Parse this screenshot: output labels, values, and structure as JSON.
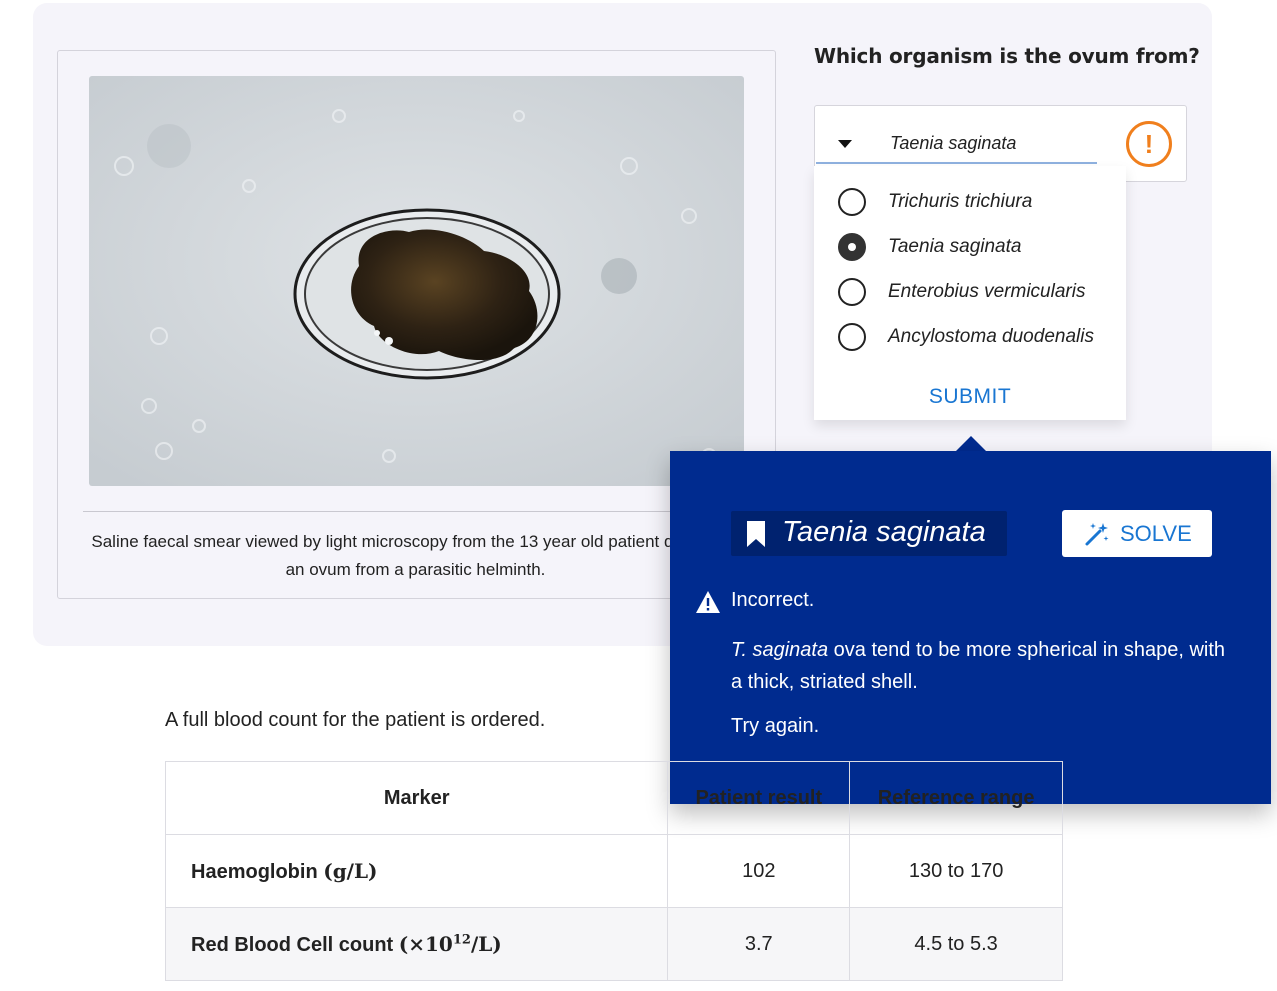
{
  "figure": {
    "caption": "Saline faecal smear viewed by light microscopy from the 13 year old patient displaying an ovum from a parasitic helminth."
  },
  "question": {
    "prompt": "Which organism is the ovum from?",
    "selected_value": "Taenia saginata",
    "options": [
      {
        "label": "Trichuris trichiura",
        "checked": false
      },
      {
        "label": "Taenia saginata",
        "checked": true
      },
      {
        "label": "Enterobius vermicularis",
        "checked": false
      },
      {
        "label": "Ancylostoma duodenalis",
        "checked": false
      }
    ],
    "submit_label": "SUBMIT",
    "status_icon": "alert-icon",
    "status_color": "#f07f1d"
  },
  "feedback": {
    "answer": "Taenia saginata",
    "solve_label": "SOLVE",
    "verdict": "Incorrect.",
    "explanation_italic": "T. saginata",
    "explanation_rest": " ova tend to be more spherical in shape, with a thick, striated shell.",
    "retry": "Try again.",
    "background": "#002b8f"
  },
  "fbc": {
    "intro": "A full blood count for the patient is ordered.",
    "headers": [
      "Marker",
      "Patient result",
      "Reference range"
    ],
    "rows": [
      {
        "marker": "Haemoglobin",
        "unit": "(g/L)",
        "result": "102",
        "range": "130 to 170"
      },
      {
        "marker": "Red Blood Cell count",
        "unit_prefix": "(×10",
        "unit_exp": "12",
        "unit_suffix": "/L)",
        "result": "3.7",
        "range": "4.5 to 5.3"
      }
    ]
  }
}
